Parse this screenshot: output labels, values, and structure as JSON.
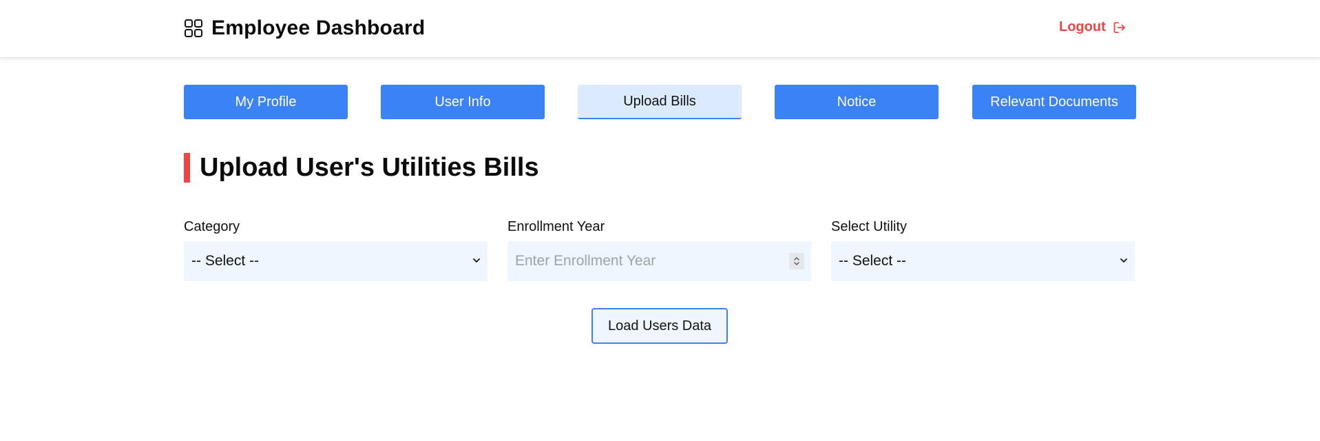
{
  "header": {
    "title": "Employee Dashboard",
    "brand_icon": "grid-icon",
    "logout_label": "Logout",
    "logout_icon": "logout-icon",
    "logout_color": "#ef4444"
  },
  "tabs": [
    {
      "label": "My Profile",
      "active": false
    },
    {
      "label": "User Info",
      "active": false
    },
    {
      "label": "Upload Bills",
      "active": true
    },
    {
      "label": "Notice",
      "active": false
    },
    {
      "label": "Relevant Documents",
      "active": false
    }
  ],
  "colors": {
    "tab_bg": "#3b82f6",
    "tab_active_bg": "#dbeafe",
    "field_bg": "#eff6ff",
    "accent_bar": "#ef4444"
  },
  "main": {
    "section_title": "Upload User's Utilities Bills",
    "fields": {
      "category": {
        "label": "Category",
        "value": "-- Select --"
      },
      "enrollment_year": {
        "label": "Enrollment Year",
        "placeholder": "Enter Enrollment Year",
        "value": ""
      },
      "utility": {
        "label": "Select Utility",
        "value": "-- Select --"
      }
    },
    "load_button_label": "Load Users Data"
  }
}
